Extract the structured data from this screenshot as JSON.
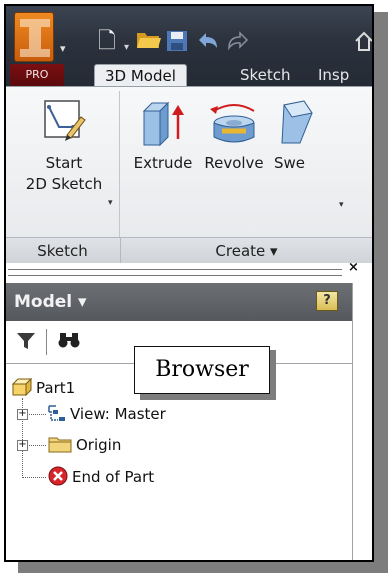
{
  "app": {
    "product_badge": "PRO",
    "logo_icon": "inventor-logo-icon",
    "accent_color": "#e07a18"
  },
  "quick_access": {
    "items": [
      {
        "name": "new",
        "icon": "new-document-icon"
      },
      {
        "name": "open",
        "icon": "open-folder-icon"
      },
      {
        "name": "save",
        "icon": "save-icon"
      },
      {
        "name": "undo",
        "icon": "undo-icon"
      },
      {
        "name": "redo",
        "icon": "redo-icon"
      },
      {
        "name": "home",
        "icon": "home-icon"
      }
    ]
  },
  "ribbon": {
    "tabs": [
      {
        "label": "3D Model",
        "active": true
      },
      {
        "label": "Sketch",
        "active": false
      },
      {
        "label": "Insp",
        "active": false
      }
    ],
    "tools": {
      "start_sketch_line1": "Start",
      "start_sketch_line2": "2D Sketch",
      "extrude": "Extrude",
      "revolve": "Revolve",
      "sweep": "Swe"
    },
    "panels": {
      "sketch": "Sketch",
      "create": "Create ▾"
    }
  },
  "browser": {
    "close_glyph": "×",
    "title": "Model ▾",
    "help_glyph": "?",
    "tree": [
      {
        "label": "Part1",
        "icon": "part-icon"
      },
      {
        "label": "View: Master",
        "icon": "view-rep-icon"
      },
      {
        "label": "Origin",
        "icon": "folder-icon"
      },
      {
        "label": "End of Part",
        "icon": "end-of-part-icon"
      }
    ]
  },
  "callout": {
    "label": "Browser"
  }
}
